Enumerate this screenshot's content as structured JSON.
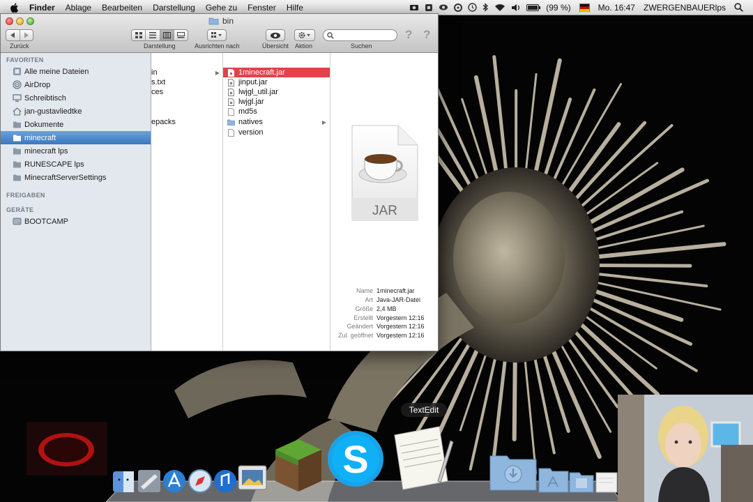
{
  "menubar": {
    "app": "Finder",
    "menus": [
      "Ablage",
      "Bearbeiten",
      "Darstellung",
      "Gehe zu",
      "Fenster",
      "Hilfe"
    ],
    "battery": "(99 %)",
    "clock": "Mo. 16:47",
    "user": "ZWERGENBAUERlps"
  },
  "window": {
    "title": "bin",
    "back_label": "Zurück",
    "view_label": "Darstellung",
    "arrange_label": "Ausrichten nach",
    "quicklook_label": "Übersicht",
    "action_label": "Aktion",
    "search_label": "Suchen",
    "search_value": ""
  },
  "sidebar": {
    "favorites_header": "FAVORITEN",
    "favorites": [
      {
        "label": "Alle meine Dateien",
        "icon": "all-files-icon"
      },
      {
        "label": "AirDrop",
        "icon": "airdrop-icon"
      },
      {
        "label": "Schreibtisch",
        "icon": "desktop-icon"
      },
      {
        "label": "jan-gustavliedtke",
        "icon": "home-icon"
      },
      {
        "label": "Dokumente",
        "icon": "documents-icon"
      },
      {
        "label": "minecraft",
        "icon": "folder-icon",
        "selected": true
      },
      {
        "label": "minecraft lps",
        "icon": "folder-icon"
      },
      {
        "label": "RUNESCAPE lps",
        "icon": "folder-icon"
      },
      {
        "label": "MinecraftServerSettings",
        "icon": "folder-icon"
      }
    ],
    "shared_header": "FREIGABEN",
    "devices_header": "GERÄTE",
    "devices": [
      {
        "label": "BOOTCAMP",
        "icon": "disk-icon"
      }
    ]
  },
  "column1": {
    "items": [
      {
        "label": "in",
        "has_arrow": true
      },
      {
        "label": "s.txt",
        "has_arrow": false
      },
      {
        "label": "ces",
        "has_arrow": false
      },
      {
        "label": "",
        "has_arrow": false
      },
      {
        "label": "",
        "has_arrow": false
      },
      {
        "label": "epacks",
        "has_arrow": false
      }
    ]
  },
  "column2": {
    "items": [
      {
        "label": "1minecraft.jar",
        "type": "file",
        "selected": true
      },
      {
        "label": "jinput.jar",
        "type": "file"
      },
      {
        "label": "lwjgl_util.jar",
        "type": "file"
      },
      {
        "label": "lwjgl.jar",
        "type": "file"
      },
      {
        "label": "md5s",
        "type": "doc"
      },
      {
        "label": "natives",
        "type": "folder",
        "has_arrow": true
      },
      {
        "label": "version",
        "type": "doc"
      }
    ]
  },
  "preview": {
    "icon_label": "JAR",
    "info": [
      {
        "key": "Name",
        "value": "1minecraft.jar"
      },
      {
        "key": "Art",
        "value": "Java-JAR-Datei"
      },
      {
        "key": "Größe",
        "value": "2,4 MB"
      },
      {
        "key": "Erstellt",
        "value": "Vorgestern 12:16"
      },
      {
        "key": "Geändert",
        "value": "Vorgestern 12:16"
      },
      {
        "key": "Zul. geöffnet",
        "value": "Vorgestern 12:16"
      }
    ]
  },
  "dock": {
    "tooltip": "TextEdit",
    "items": [
      "finder-icon",
      "mail-icon",
      "app-store-icon",
      "safari-icon",
      "itunes-icon",
      "iphoto-icon",
      "minecraft-icon",
      "skype-icon",
      "textedit-icon",
      "downloads-icon",
      "applications-icon",
      "documents-stack-icon",
      "recent-icon"
    ]
  },
  "colors": {
    "selection_red": "#e3414c",
    "sidebar_selection": "#3a78c0",
    "sidebar_bg": "#e3e8ee"
  }
}
